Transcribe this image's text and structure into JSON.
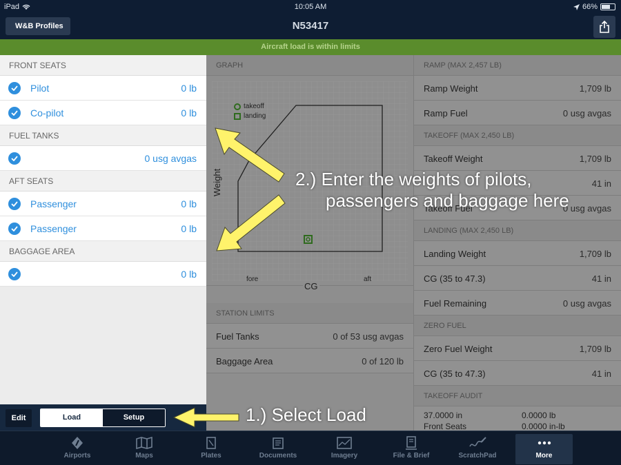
{
  "status_bar": {
    "device": "iPad",
    "time": "10:05 AM",
    "battery_percent_text": "66%",
    "battery_level": 0.66
  },
  "nav": {
    "back_label": "W&B Profiles",
    "title": "N53417"
  },
  "banner": {
    "message": "Aircraft load is within limits"
  },
  "left": {
    "sections": [
      {
        "header": "FRONT SEATS",
        "rows": [
          {
            "label": "Pilot",
            "value": "0 lb"
          },
          {
            "label": "Co-pilot",
            "value": "0 lb"
          }
        ]
      },
      {
        "header": "FUEL TANKS",
        "rows": [
          {
            "label": "",
            "value": "0 usg avgas"
          }
        ]
      },
      {
        "header": "AFT SEATS",
        "rows": [
          {
            "label": "Passenger",
            "value": "0 lb"
          },
          {
            "label": "Passenger",
            "value": "0 lb"
          }
        ]
      },
      {
        "header": "BAGGAGE AREA",
        "rows": [
          {
            "label": "",
            "value": "0 lb"
          }
        ]
      }
    ],
    "toolbar": {
      "edit_label": "Edit",
      "seg_load": "Load",
      "seg_setup": "Setup"
    }
  },
  "graph": {
    "header": "GRAPH",
    "legend_takeoff": "takeoff",
    "legend_landing": "landing",
    "y_label": "Weight",
    "x_label": "CG",
    "x_left": "fore",
    "x_right": "aft"
  },
  "station_limits": {
    "header": "STATION LIMITS",
    "rows": [
      {
        "label": "Fuel Tanks",
        "value": "0 of 53 usg avgas"
      },
      {
        "label": "Baggage Area",
        "value": "0 of 120 lb"
      }
    ]
  },
  "right": {
    "ramp_header": "RAMP (MAX 2,457 LB)",
    "ramp_rows": [
      {
        "label": "Ramp Weight",
        "value": "1,709 lb"
      },
      {
        "label": "Ramp Fuel",
        "value": "0 usg avgas"
      }
    ],
    "takeoff_header": "TAKEOFF (MAX 2,450 LB)",
    "takeoff_rows": [
      {
        "label": "Takeoff Weight",
        "value": "1,709 lb"
      },
      {
        "label": "",
        "value": "41 in"
      },
      {
        "label": "Takeoff Fuel",
        "value": "0 usg avgas"
      }
    ],
    "landing_header": "LANDING (MAX 2,450 LB)",
    "landing_rows": [
      {
        "label": "Landing Weight",
        "value": "1,709 lb"
      },
      {
        "label": "CG (35 to 47.3)",
        "value": "41 in"
      },
      {
        "label": "Fuel Remaining",
        "value": "0 usg avgas"
      }
    ],
    "zero_header": "ZERO FUEL",
    "zero_rows": [
      {
        "label": "Zero Fuel Weight",
        "value": "1,709 lb"
      },
      {
        "label": "CG (35 to 47.3)",
        "value": "41 in"
      }
    ],
    "audit_header": "TAKEOFF AUDIT",
    "audit_line1_a": "37.0000 in",
    "audit_line1_b": "0.0000 lb",
    "audit_line2_a": "Front Seats",
    "audit_line2_b": "0.0000 in-lb"
  },
  "annotations": {
    "step2_line1": "2.) Enter the weights of pilots,",
    "step2_line2": "passengers and baggage here",
    "step1": "1.) Select Load"
  },
  "tabs": [
    {
      "label": "Airports",
      "icon": "airport-icon"
    },
    {
      "label": "Maps",
      "icon": "map-icon"
    },
    {
      "label": "Plates",
      "icon": "plates-icon"
    },
    {
      "label": "Documents",
      "icon": "documents-icon"
    },
    {
      "label": "Imagery",
      "icon": "imagery-icon"
    },
    {
      "label": "File & Brief",
      "icon": "file-brief-icon"
    },
    {
      "label": "ScratchPad",
      "icon": "scratchpad-icon"
    },
    {
      "label": "More",
      "icon": "more-icon"
    }
  ],
  "colors": {
    "accent": "#2f8fdd",
    "banner_green": "#5a8c2c",
    "nav_dark": "#0e1d33",
    "annotation_yellow": "#fff36b"
  }
}
